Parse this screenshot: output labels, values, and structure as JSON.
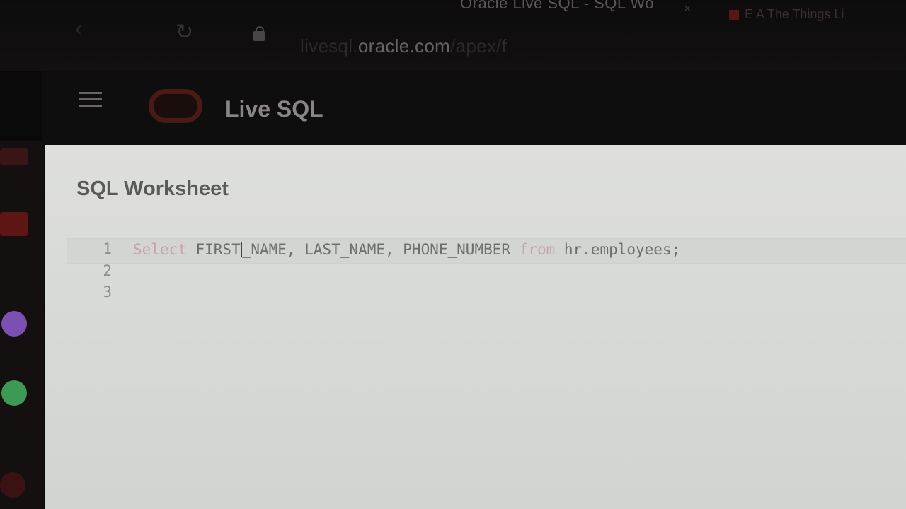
{
  "browser": {
    "tab_title": "Oracle Live SQL - SQL Wo",
    "tab_close": "×",
    "bookmarks_text": "E  A  The Things Li",
    "url_prefix": "livesql.",
    "url_domain": "oracle.com",
    "url_path": "/apex/f"
  },
  "header": {
    "app_title": "Live SQL"
  },
  "worksheet": {
    "title": "SQL Worksheet",
    "line_numbers": [
      "1",
      "2",
      "3"
    ],
    "code": {
      "kw_select": "Select",
      "before_cursor": " FIRST",
      "after_cursor": "_NAME, LAST_NAME, PHONE_NUMBER ",
      "kw_from": "from",
      "tail": " hr.employees;"
    }
  },
  "colors": {
    "keyword": "#c4a6a6",
    "code_text": "#6e6e6e",
    "background": "#0b0a0a",
    "worksheet_bg": "#dedfdd"
  }
}
